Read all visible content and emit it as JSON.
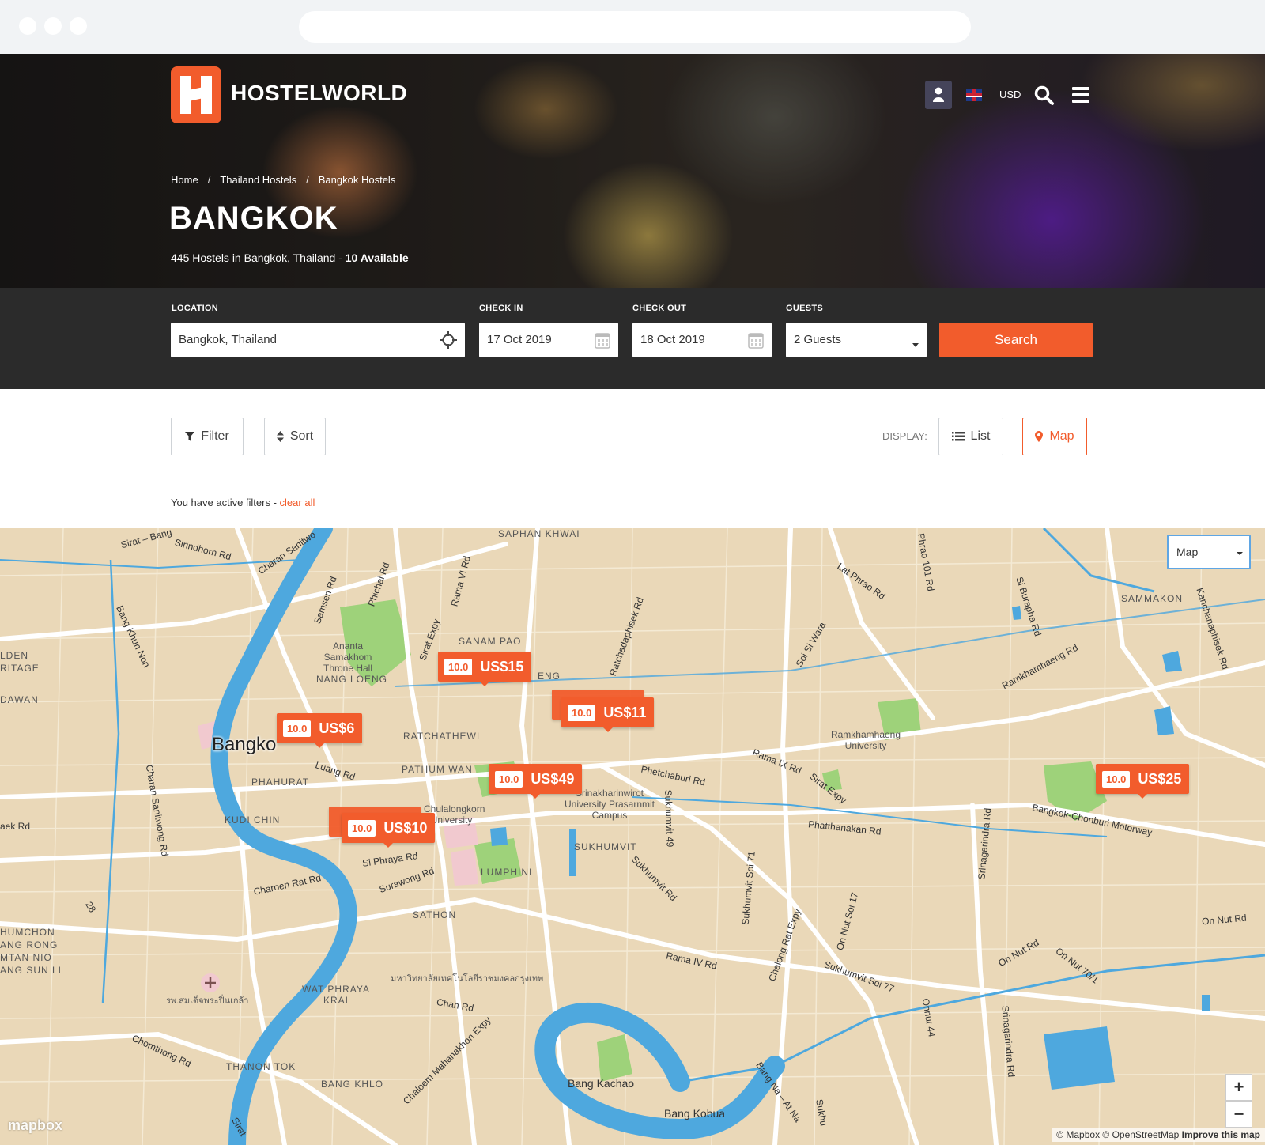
{
  "header": {
    "brand": "HOSTELWORLD",
    "currency": "USD"
  },
  "breadcrumb": [
    "Home",
    "Thailand Hostels",
    "Bangkok Hostels"
  ],
  "breadcrumb_sep": "/",
  "hero": {
    "title": "BANGKOK",
    "subtitle": "445 Hostels in Bangkok, Thailand - ",
    "available": "10 Available"
  },
  "search": {
    "location_label": "LOCATION",
    "location_value": "Bangkok, Thailand",
    "checkin_label": "CHECK IN",
    "checkin_value": "17 Oct 2019",
    "checkout_label": "CHECK OUT",
    "checkout_value": "18 Oct 2019",
    "guests_label": "GUESTS",
    "guests_value": "2 Guests",
    "search_button": "Search"
  },
  "toolbar": {
    "filter": "Filter",
    "sort": "Sort",
    "display_label": "DISPLAY:",
    "list": "List",
    "map": "Map"
  },
  "filters_note": {
    "text": "You have active filters - ",
    "clear": "clear all"
  },
  "map": {
    "type_select": "Map",
    "city_label": "Bangko",
    "zoom_in": "+",
    "zoom_out": "−",
    "logo": "mapbox",
    "attribution": "© Mapbox © OpenStreetMap",
    "improve": "Improve this map",
    "pins": [
      {
        "rating": "10.0",
        "price": "US$15"
      },
      {
        "rating": "10.0",
        "price": "US$11"
      },
      {
        "rating": "10.0",
        "price": "US$6"
      },
      {
        "rating": "10.0",
        "price": "US$49"
      },
      {
        "rating": "10.0",
        "price": "US$25"
      },
      {
        "rating": "10.0",
        "price": "US$10"
      }
    ],
    "districts": [
      "SAPHAN KHWAI",
      "SANAM PAO",
      "NANG LOENG",
      "RATCHATHEWI",
      "PATHUM WAN",
      "PHAHURAT",
      "KUDI CHIN",
      "SUKHUMVIT",
      "LUMPHINI",
      "SATHON",
      "WAT PHRAYA KRAI",
      "THANON TOK",
      "BANG KHLO",
      "SAMMAKON",
      "ENG"
    ],
    "places": [
      "Ananta Samakhom Throne Hall",
      "Chulalongkorn University",
      "Srinakharinwirot University Prasarnmit Campus",
      "Ramkhamhaeng University",
      "Bang Kachao",
      "Bang Kobua",
      "มหาวิทยาลัยเทคโนโลยีราชมงคลกรุงเทพ",
      "รพ.สมเด็จพระปิ่นเกล้า"
    ],
    "edge_labels": [
      "LDEN",
      "RITAGE",
      "DAWAN",
      "HUMCHON",
      "ANG RONG",
      "MTAN NIO",
      "ANG SUN LI"
    ],
    "roads": [
      "Sirat – Bang",
      "Sirindhorn Rd",
      "Charan Sanitwo",
      "Samsen Rd",
      "Phichai Rd",
      "Rama VI Rd",
      "Sirat Expy",
      "Phrao 101 Rd",
      "Lat Phrao Rd",
      "Si Burapha Rd",
      "Kanchanaphisek Rd",
      "Bang Khun Non",
      "Ratchadaphisek Rd",
      "Soi Si Wara",
      "Ramkhamhaeng Rd",
      "Luang Rd",
      "Rama IX Rd",
      "Sirat Expy",
      "Phetchaburi Rd",
      "Charan Sanitwong Rd",
      "Bangkok-Chonburi Motorway",
      "Phatthanakan Rd",
      "Srinagarindra Rd",
      "Sukhumvit 49",
      "Si Phraya Rd",
      "Surawong Rd",
      "Charoen Rat Rd",
      "Sukhumvit Rd",
      "Sukhumvit Soi 71",
      "Chalong Rat Expy",
      "On Nut Soi 17",
      "On Nut Rd",
      "On Nut Rd",
      "On Nut 70/1",
      "Rama IV Rd",
      "Sukhumvit Soi 77",
      "Onnut 44",
      "Chan Rd",
      "Chomthong Rd",
      "Chaloem Mahanakhon Expy",
      "Bang Na – At Na",
      "Srinagarindra Rd",
      "Sukhu",
      "aek Rd",
      "28",
      "Sirat"
    ]
  },
  "colors": {
    "accent": "#f25c2c",
    "searchbar_bg": "#2b2b2b",
    "map_land": "#ead8b8",
    "map_water": "#4ea8de",
    "map_park": "#9ed27a"
  }
}
